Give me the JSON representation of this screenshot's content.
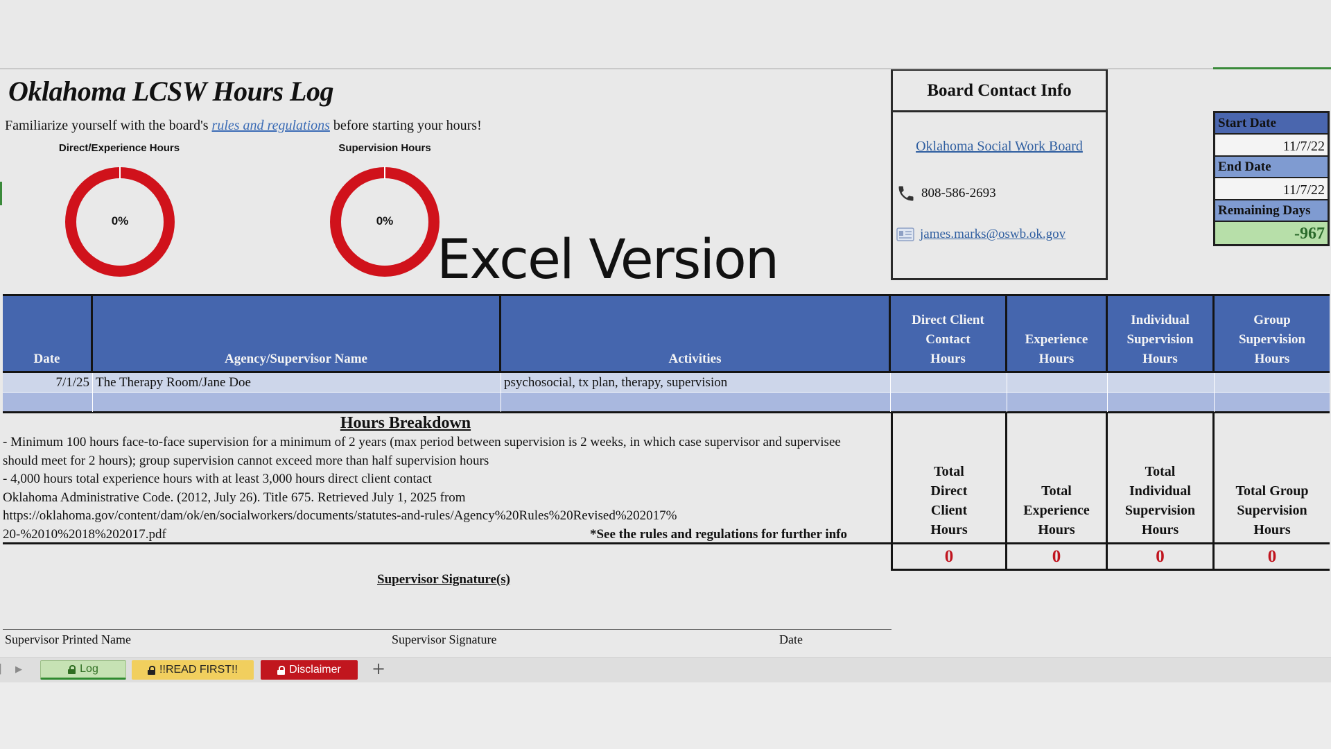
{
  "header": {
    "title": "Oklahoma LCSW Hours Log",
    "subtitle_before": "Familiarize yourself with the board's ",
    "subtitle_link": "rules and regulations",
    "subtitle_after": " before starting your hours!"
  },
  "rings": [
    {
      "label": "Direct/Experience Hours",
      "percent_text": "0%",
      "color": "#d0121b"
    },
    {
      "label": "Supervision Hours",
      "percent_text": "0%",
      "color": "#d0121b"
    }
  ],
  "watermark": "Excel Version",
  "contact": {
    "title": "Board Contact Info",
    "board_link": "Oklahoma Social Work Board",
    "phone": "808-586-2693",
    "email": "james.marks@oswb.ok.gov"
  },
  "dates": {
    "start_label": "Start Date",
    "start_value": "11/7/22",
    "end_label": "End Date",
    "end_value": "11/7/22",
    "remaining_label": "Remaining Days",
    "remaining_value": "-967"
  },
  "table": {
    "headers": [
      "Date",
      "Agency/Supervisor Name",
      "Activities",
      "Direct Client Contact Hours",
      "Experience Hours",
      "Individual Supervision Hours",
      "Group Supervision Hours"
    ],
    "rows": [
      {
        "date": "7/1/25",
        "agency": "The Therapy Room/Jane Doe",
        "activities": "psychosocial, tx plan, therapy, supervision"
      }
    ]
  },
  "breakdown": {
    "title": "Hours Breakdown",
    "line1": "- Minimum 100 hours face-to-face supervision for a minimum of 2 years (max period between supervision is 2 weeks, in which case supervisor and supervisee should meet for 2 hours); group supervision cannot exceed more than half supervision hours",
    "line2": "- 4,000 hours total experience hours with at least 3,000 hours direct client contact",
    "line3": "Oklahoma Administrative Code. (2012, July 26). Title 675. Retrieved July 1, 2025 from",
    "line4": "https://oklahoma.gov/content/dam/ok/en/socialworkers/documents/statutes-and-rules/Agency%20Rules%20Revised%202017%",
    "line5": "20-%2010%2018%202017.pdf",
    "note": "*See the rules and regulations for further info"
  },
  "totals": [
    {
      "label": "Total Direct Client Hours",
      "value": "0"
    },
    {
      "label": "Total Experience Hours",
      "value": "0"
    },
    {
      "label": "Total Individual Supervision Hours",
      "value": "0"
    },
    {
      "label": "Total Group Supervision Hours",
      "value": "0"
    }
  ],
  "signature": {
    "title": "Supervisor Signature(s)",
    "printed_name": "Supervisor Printed Name",
    "signature": "Supervisor Signature",
    "date": "Date"
  },
  "tabs": {
    "log": "Log",
    "read_first": "!!READ FIRST!!",
    "disclaimer": "Disclaimer",
    "add": "+"
  },
  "colors": {
    "header_blue": "#4566ae",
    "ring_red": "#d0121b",
    "total_red": "#c0141e",
    "remaining_green": "#b7dfa9"
  }
}
